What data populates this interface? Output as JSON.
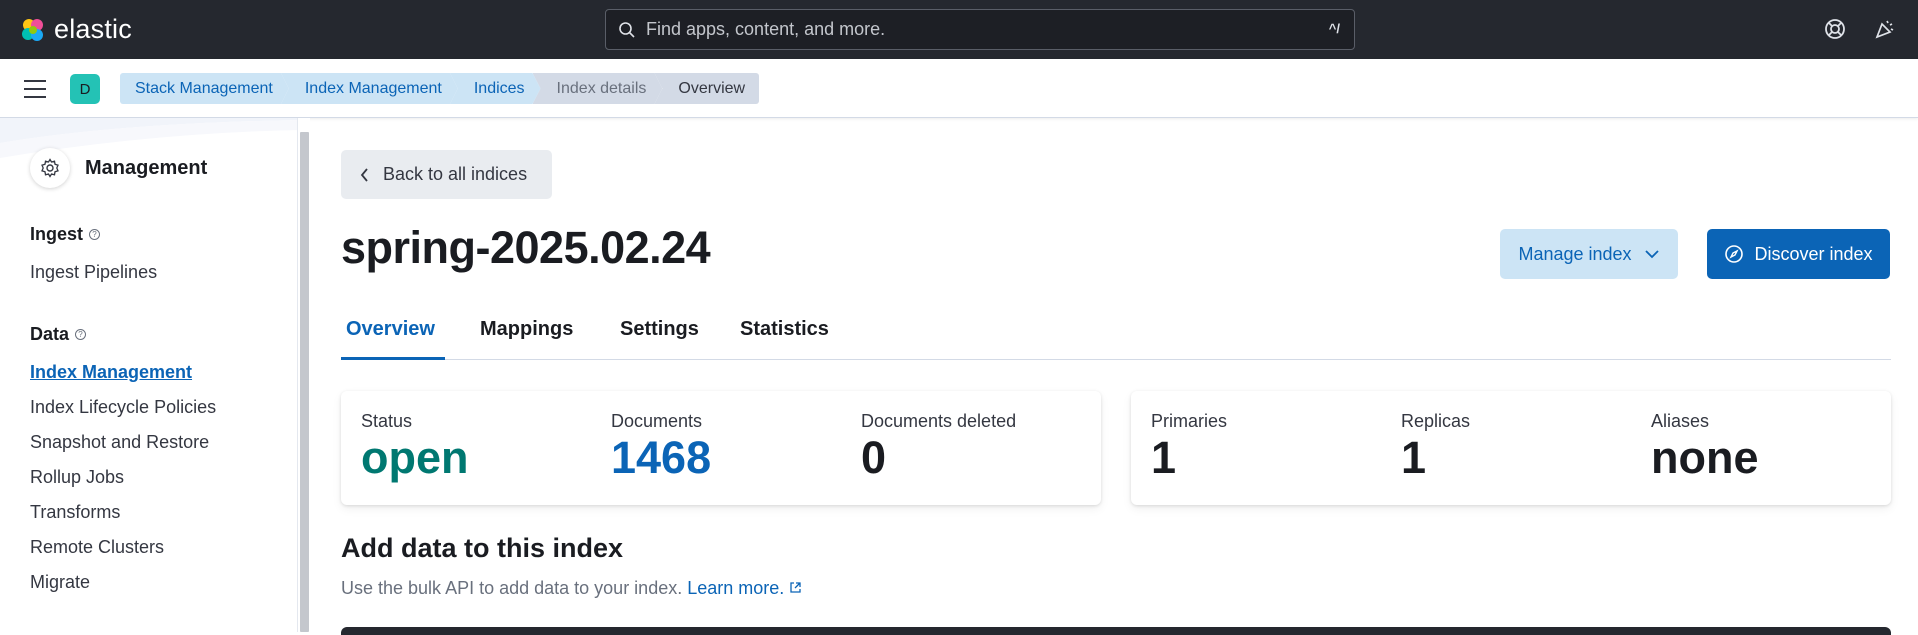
{
  "header": {
    "logo_text": "elastic",
    "search_placeholder": "Find apps, content, and more.",
    "search_shortcut": "^/"
  },
  "breadcrumbs": {
    "space_initial": "D",
    "items": [
      "Stack Management",
      "Index Management",
      "Indices",
      "Index details",
      "Overview"
    ]
  },
  "sidebar": {
    "title": "Management",
    "groups": [
      {
        "label": "Ingest",
        "items": [
          "Ingest Pipelines"
        ]
      },
      {
        "label": "Data",
        "items": [
          "Index Management",
          "Index Lifecycle Policies",
          "Snapshot and Restore",
          "Rollup Jobs",
          "Transforms",
          "Remote Clusters",
          "Migrate"
        ]
      }
    ],
    "active_item": "Index Management"
  },
  "main": {
    "back_label": "Back to all indices",
    "title": "spring-2025.02.24",
    "manage_label": "Manage index",
    "discover_label": "Discover index",
    "tabs": [
      "Overview",
      "Mappings",
      "Settings",
      "Statistics"
    ],
    "active_tab": "Overview",
    "stats_left": [
      {
        "label": "Status",
        "value": "open"
      },
      {
        "label": "Documents",
        "value": "1468"
      },
      {
        "label": "Documents deleted",
        "value": "0"
      }
    ],
    "stats_right": [
      {
        "label": "Primaries",
        "value": "1"
      },
      {
        "label": "Replicas",
        "value": "1"
      },
      {
        "label": "Aliases",
        "value": "none"
      }
    ],
    "add_title": "Add data to this index",
    "add_desc": "Use the bulk API to add data to your index.",
    "learn_more": "Learn more."
  },
  "colors": {
    "header_bg": "#25282f",
    "primary": "#0b64b6",
    "status_open": "#007871"
  }
}
